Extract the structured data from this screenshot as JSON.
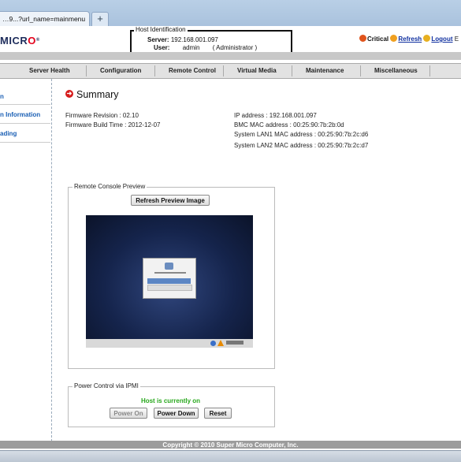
{
  "browser": {
    "tab_title": "…9...?url_name=mainmenu",
    "new_tab": "+"
  },
  "header": {
    "logo_text": "MICR",
    "logo_tail": "O",
    "host_title": "Host Identification",
    "server_label": "Server:",
    "server_value": "192.168.001.097",
    "user_label": "User:",
    "user_value": "admin",
    "user_role": "( Administrator )",
    "critical": "Critical",
    "refresh": "Refresh",
    "logout": "Logout",
    "trailing": "E"
  },
  "nav": {
    "items": [
      "Server Health",
      "Configuration",
      "Remote Control",
      "Virtual Media",
      "Maintenance",
      "Miscellaneous"
    ]
  },
  "sidebar": {
    "items": [
      "n",
      "n Information",
      "ading"
    ]
  },
  "summary": {
    "title": "Summary",
    "firmware_revision": "Firmware Revision : 02.10",
    "firmware_build": "Firmware Build Time : 2012-12-07",
    "ip": "IP address : 192.168.001.097",
    "bmc_mac": "BMC MAC address : 00:25:90:7b:2b:0d",
    "lan1_mac": "System LAN1 MAC address : 00:25:90:7b:2c:d6",
    "lan2_mac": "System LAN2 MAC address : 00:25:90:7b:2c:d7"
  },
  "remote_console": {
    "title": "Remote Console Preview",
    "refresh_button": "Refresh Preview Image"
  },
  "power": {
    "title": "Power Control via IPMI",
    "status": "Host is currently on",
    "power_on": "Power On",
    "power_down": "Power Down",
    "reset": "Reset"
  },
  "footer": {
    "copyright": "Copyright © 2010 Super Micro Computer, Inc."
  },
  "colors": {
    "accent_link": "#1030a0",
    "status_on": "#28a81c",
    "summary_icon": "#d61c1c"
  }
}
